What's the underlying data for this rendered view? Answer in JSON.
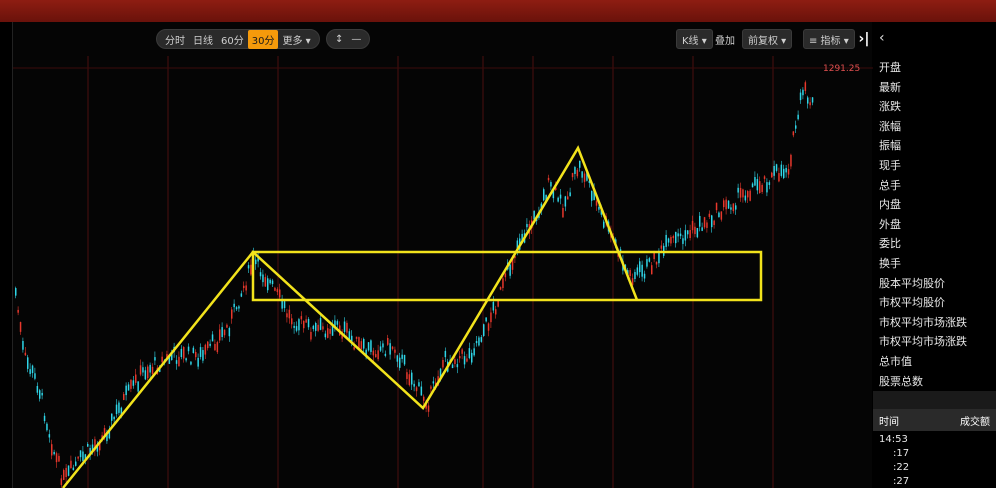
{
  "toolbar": {
    "periods": [
      {
        "label": "分时",
        "active": false
      },
      {
        "label": "日线",
        "active": false
      },
      {
        "label": "60分",
        "active": false
      },
      {
        "label": "30分",
        "active": true
      },
      {
        "label": "更多 ▾",
        "active": false
      }
    ],
    "arrows": [
      {
        "label": "↕"
      },
      {
        "label": "—"
      }
    ],
    "indicator_select": "K线 ▾",
    "overlay_label": "叠加",
    "adjust_select": "前复权 ▾",
    "extra_select": "≡ 指标 ▾",
    "collapse_icon": "›|"
  },
  "chart": {
    "price_high_label": "1291.25",
    "colors": {
      "bull": "#e8382c",
      "bear": "#2fd6e8",
      "annotation": "#f2e31c",
      "vline": "#4a0e0e"
    }
  },
  "right_panel": {
    "back_icon": "‹",
    "stats": [
      "开盘",
      "最新",
      "涨跌",
      "涨幅",
      "振幅",
      "现手",
      "总手",
      "内盘",
      "外盘",
      "委比",
      "换手",
      "股本平均股价",
      "市权平均股价",
      "市权平均市场涨跌",
      "市权平均市场涨跌",
      "总市值",
      "股票总数"
    ],
    "trade_header": {
      "time": "时间",
      "price": "成交额"
    },
    "trade_times": [
      "14:53",
      ":17",
      ":22",
      ":27"
    ]
  }
}
